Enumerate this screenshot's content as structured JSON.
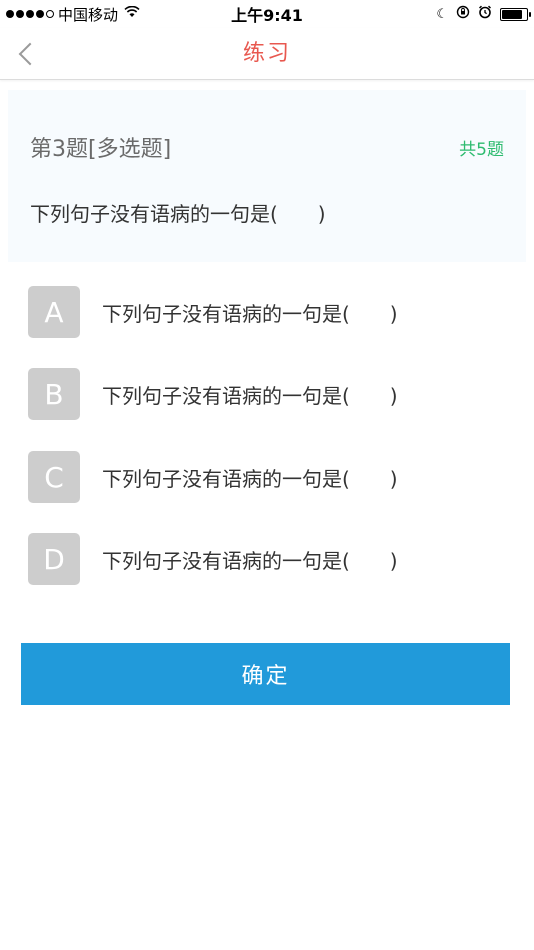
{
  "status_bar": {
    "carrier": "中国移动",
    "time": "上午9:41",
    "battery_level": 0.85
  },
  "nav": {
    "title": "练习",
    "title_color": "#e8584f"
  },
  "question": {
    "number_label": "第3题[多选题]",
    "total_label": "共5题",
    "text": "下列句子没有语病的一句是(　　)"
  },
  "options": [
    {
      "letter": "A",
      "text": "下列句子没有语病的一句是(　　)"
    },
    {
      "letter": "B",
      "text": "下列句子没有语病的一句是(　　)"
    },
    {
      "letter": "C",
      "text": "下列句子没有语病的一句是(　　)"
    },
    {
      "letter": "D",
      "text": "下列句子没有语病的一句是(　　)"
    }
  ],
  "confirm_label": "确定",
  "colors": {
    "accent_blue": "#219ada",
    "total_green": "#2dbb6f",
    "option_badge": "#cdcdcd"
  }
}
